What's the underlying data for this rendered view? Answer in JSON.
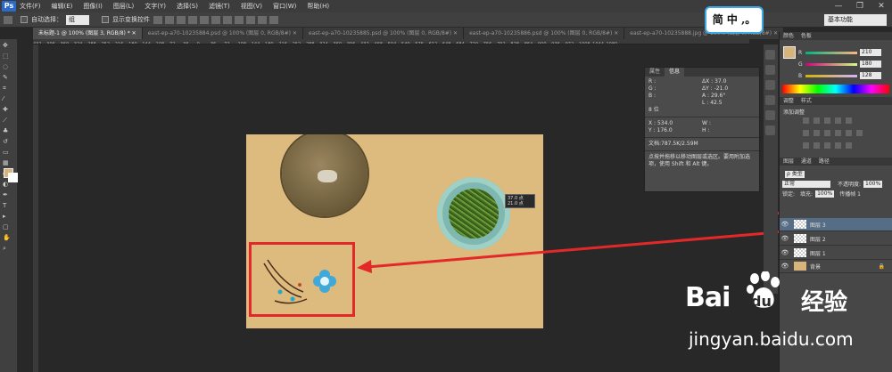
{
  "app": {
    "logo": "Ps"
  },
  "menubar": {
    "items": [
      "文件(F)",
      "编辑(E)",
      "图像(I)",
      "图层(L)",
      "文字(Y)",
      "选择(S)",
      "滤镜(T)",
      "视图(V)",
      "窗口(W)",
      "帮助(H)"
    ]
  },
  "window": {
    "minimize": "—",
    "restore": "❐",
    "close": "✕"
  },
  "options": {
    "auto_select_label": "自动选择：",
    "auto_select_value": "组",
    "transform_label": "显示变换控件"
  },
  "workspace": {
    "label": "基本功能"
  },
  "badge": {
    "text": "简 中 ,。"
  },
  "tabs": [
    "未标题-1 @ 100% (图层 3, RGB/8) * ✕",
    "east-ep-a70-10235884.psd @ 100% (图层 0, RGB/8#) ✕",
    "east-ep-a70-10235885.psd @ 100% (图层 0, RGB/8#) ✕",
    "east-ep-a70-10235886.psd @ 100% (图层 0, RGB/8#) ✕",
    "east-ep-a70-10235888.jpg @ 100% (图层 0, RGB/8#) ✕"
  ],
  "ruler": [
    "432",
    "396",
    "360",
    "324",
    "288",
    "252",
    "216",
    "180",
    "144",
    "108",
    "72",
    "36",
    "0",
    "36",
    "72",
    "108",
    "144",
    "180",
    "216",
    "252",
    "288",
    "324",
    "360",
    "396",
    "432",
    "468",
    "504",
    "540",
    "576",
    "612",
    "648",
    "684",
    "720",
    "756",
    "792",
    "828",
    "864",
    "900",
    "936",
    "972",
    "1008",
    "1044",
    "1080"
  ],
  "tooltip": {
    "x": "37.0 点",
    "y": "21.0 点"
  },
  "info": {
    "tabs": [
      "属性",
      "信息"
    ],
    "r": "R :",
    "g": "G :",
    "b": "B :",
    "bits": "8 位",
    "dx_label": "ΔX :",
    "dx": "37.0",
    "dy_label": "ΔY :",
    "dy": "-21.0",
    "a_label": "A :",
    "a": "29.6°",
    "l_label": "L :",
    "l": "42.5",
    "x_label": "X :",
    "x": "534.0",
    "y_label": "Y :",
    "y": "176.0",
    "w_label": "W :",
    "h_label": "H :",
    "doc": "文档:787.5K/2.59M",
    "hint": "点按并拖移以移动图层或选区。要用附加选项，使用 Shift 和 Alt 键。"
  },
  "color_panel": {
    "tabs": "颜色 色板",
    "r": {
      "label": "R",
      "value": "210"
    },
    "g": {
      "label": "G",
      "value": "180"
    },
    "b": {
      "label": "B",
      "value": "128"
    },
    "swatch": "#d6b47c"
  },
  "adjust_panel": {
    "tabs": "调整 样式",
    "title": "添加调整"
  },
  "layers_panel": {
    "tabs": "图层 通道 路径",
    "kind": "ρ 类型",
    "blend": "正常",
    "opacity_label": "不透明度:",
    "opacity": "100%",
    "lock_label": "锁定:",
    "fill_label": "填充:",
    "fill": "100%",
    "propagate": "传播帧 1",
    "layers": [
      {
        "name": "图层 3",
        "selected": true
      },
      {
        "name": "图层 2",
        "selected": false
      },
      {
        "name": "图层 1",
        "selected": false
      },
      {
        "name": "背景",
        "selected": false,
        "locked": true
      }
    ]
  },
  "watermark": {
    "bai": "Bai",
    "du": "du",
    "jingyan": "经验",
    "url": "jingyan.baidu.com"
  },
  "colors": {
    "accent_red": "#e3282a",
    "fg": "#d6b47c",
    "canvas": "#ddba7e"
  }
}
